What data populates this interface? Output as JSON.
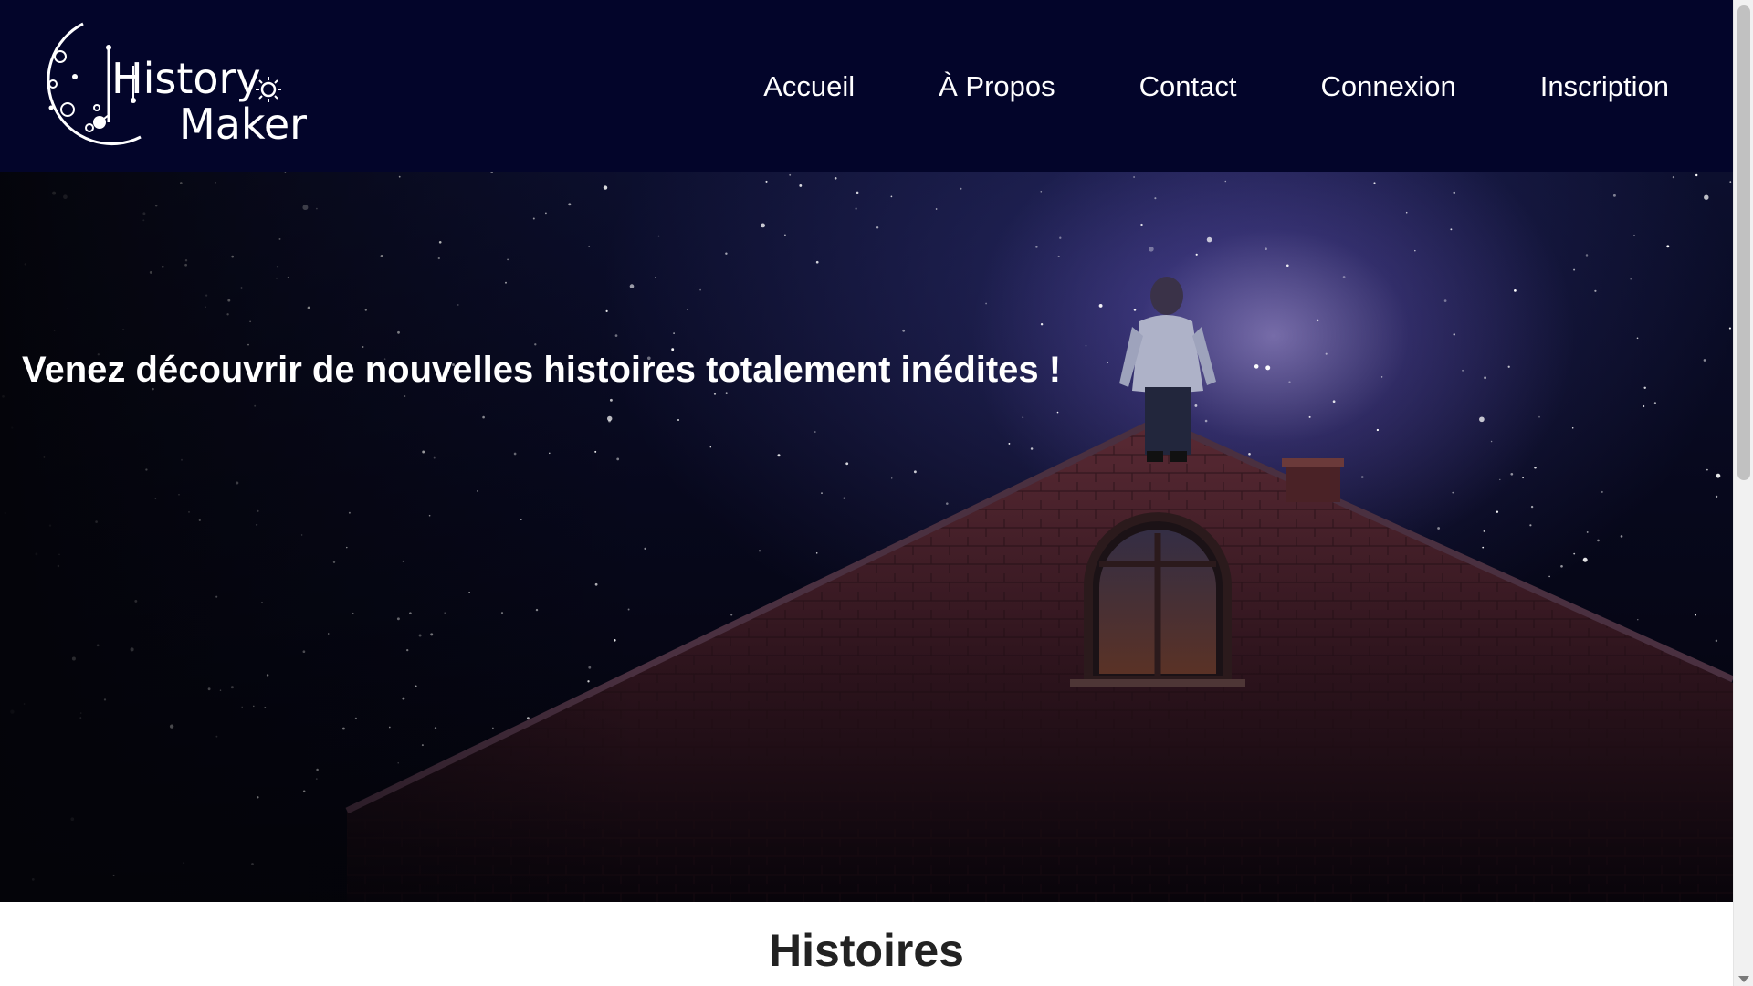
{
  "logo": {
    "line1": "History",
    "line2": "Maker"
  },
  "nav": [
    {
      "label": "Accueil"
    },
    {
      "label": "À Propos"
    },
    {
      "label": "Contact"
    },
    {
      "label": "Connexion"
    },
    {
      "label": "Inscription"
    }
  ],
  "hero": {
    "tagline": "Venez découvrir de nouvelles histoires totalement inédites !"
  },
  "section": {
    "title": "Histoires"
  },
  "colors": {
    "header_bg": "#03052a",
    "nav_text": "#ffffff",
    "section_title": "#222222"
  }
}
